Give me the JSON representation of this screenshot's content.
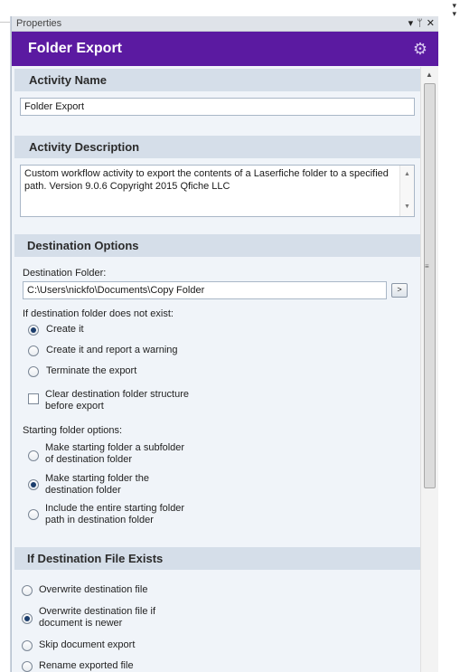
{
  "window": {
    "title": "Properties",
    "controls": [
      "▾",
      "ᛘ",
      "✕"
    ]
  },
  "header": {
    "title": "Folder Export"
  },
  "activity_name": {
    "heading": "Activity Name",
    "value": "Folder Export"
  },
  "activity_description": {
    "heading": "Activity Description",
    "line1": "Custom workflow activity to export the contents of a Laserfiche folder to a specified",
    "line2": "path.  Version 9.0.6  Copyright 2015 Qfiche LLC"
  },
  "destination": {
    "heading": "Destination Options",
    "folder_label": "Destination Folder:",
    "folder_value": "C:\\Users\\nickfo\\Documents\\Copy Folder",
    "browse_label": ">",
    "not_exist_label": "If destination folder does not exist:",
    "not_exist_options": [
      {
        "label": "Create it",
        "selected": true
      },
      {
        "label": "Create it and report a warning",
        "selected": false
      },
      {
        "label": "Terminate the export",
        "selected": false
      }
    ],
    "clear_structure": {
      "line1": "Clear destination folder structure",
      "line2": "before export",
      "checked": false
    },
    "starting_label": "Starting folder options:",
    "starting_options": [
      {
        "line1": "Make starting folder a subfolder",
        "line2": "of destination folder",
        "selected": false
      },
      {
        "line1": "Make starting folder the",
        "line2": "destination folder",
        "selected": true
      },
      {
        "line1": "Include the entire starting folder",
        "line2": "path in destination folder",
        "selected": false
      }
    ]
  },
  "file_exists": {
    "heading": "If Destination File Exists",
    "options": [
      {
        "line1": "Overwrite destination file",
        "line2": "",
        "selected": false
      },
      {
        "line1": "Overwrite destination file if",
        "line2": "document is newer",
        "selected": true
      },
      {
        "line1": "Skip document export",
        "line2": "",
        "selected": false
      },
      {
        "line1": "Rename exported file",
        "line2": "",
        "selected": false
      }
    ]
  },
  "colors": {
    "header_bg": "#5b1aa1",
    "section_bg": "#d5dee9",
    "panel_bg": "#f0f4f9"
  }
}
